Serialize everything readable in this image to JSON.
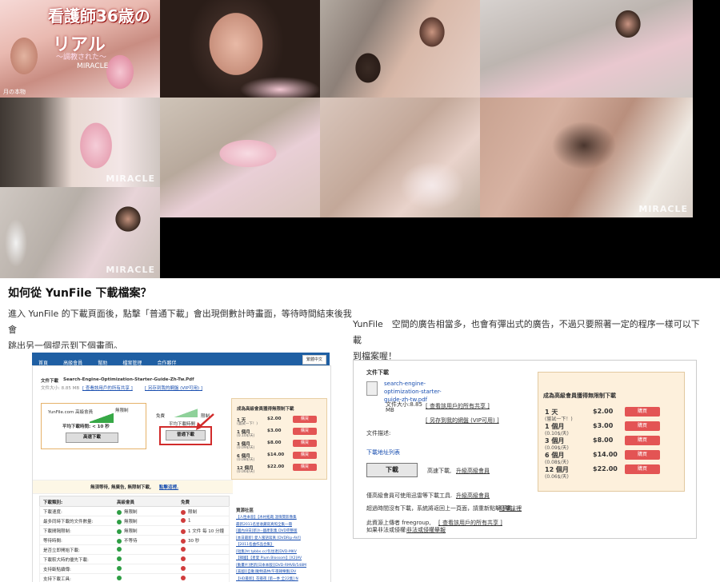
{
  "cover": {
    "title": "看護師36歳の",
    "subtitle": "リアル",
    "tagline": "～調教された～",
    "brand": "MIRACLE",
    "side_text": "月の本物"
  },
  "watermark": "MIRACLE",
  "section": {
    "heading": "如何從 YunFile 下載檔案？",
    "left_paragraph_line1": "進入 YunFile 的下載頁面後，點擊「普通下載」會出現倒數計時畫面，等待時間結束後我會",
    "left_paragraph_line2": "跳出另一個提示到下個畫面。",
    "right_paragraph_line1": "YunFile　空間的廣告相當多，也會有彈出式的廣告，不過只要照著一定的程序一樣可以下載",
    "right_paragraph_line2": "到檔案喔！"
  },
  "shot1": {
    "nav": [
      "首頁",
      "高級會員",
      "幫助",
      "檔案管理",
      "合作夥伴"
    ],
    "lang": "繁體中文",
    "file_heading": "文件下載",
    "file_name": "Search-Engine-Optimization-Starter-Guide-Zh-Tw.Pdf",
    "file_size": "文件大小: 8.85 MB",
    "link1": "[ 查看該用戶的所有共享 ]",
    "link2": "[ 另存到我的網盤 (VIP可用) ]",
    "site_box": "YunFile.com 高級會員",
    "no_limit": "無限制",
    "avg_time": "平均下載時間: < 10 秒",
    "fast_btn": "高速下載",
    "free_label": "免費",
    "limit_label": "限制",
    "avg_short": "平均下載時間",
    "normal_btn": "普通下載",
    "price_heading": "成為高級會員獲得無限制下載",
    "plans": [
      {
        "name": "1 天",
        "note": "(嘗試一下！)",
        "price": "$2.00",
        "btn": "購買"
      },
      {
        "name": "1 個月",
        "note": "(0.10$/天)",
        "price": "$3.00",
        "btn": "購買"
      },
      {
        "name": "3 個月",
        "note": "(0.09$/天)",
        "price": "$8.00",
        "btn": "購買"
      },
      {
        "name": "6 個月",
        "note": "(0.08$/天)",
        "price": "$14.00",
        "btn": "購買"
      },
      {
        "name": "12 個月",
        "note": "(0.06$/天)",
        "price": "$22.00",
        "btn": "購買"
      }
    ],
    "banner": "無須等待, 無廣告, 無限制下載,",
    "banner_link": "點擊這裡.",
    "table_headers": [
      "下載類別:",
      "高級會員",
      "免費"
    ],
    "table_rows": [
      {
        "label": "下載速度:",
        "vip": "無限制",
        "free": "限制"
      },
      {
        "label": "最多同時下載的文件數量:",
        "vip": "無限制",
        "free": "1"
      },
      {
        "label": "下載間隔限制:",
        "vip": "無限制",
        "free": "1 文件 每 10 分鐘"
      },
      {
        "label": "等待時間:",
        "vip": "不等待",
        "free": "30 秒"
      },
      {
        "label": "是否立即開始下載:",
        "vip": "",
        "free": ""
      },
      {
        "label": "下載較大時的優先下載:",
        "vip": "",
        "free": ""
      },
      {
        "label": "支持斷點續傳:",
        "vip": "",
        "free": ""
      },
      {
        "label": "支持下載工具:",
        "vip": "",
        "free": ""
      }
    ],
    "hot_heading": "資源社區",
    "hot_items": [
      "【人性本惡】【木村拓哉 溫情獎影像集",
      "最新2011名星收藏寫真照全集一冊",
      "[國內/8日]新沙--國產影集 DVD完整版",
      "[本日最新] 愛人蜜語寫真 [DVDRip-AVI]",
      "【2011名曲作品合集】",
      "[短集]ht tpbbs.cc/包住達[DVD-MKV",
      "【韓國】【星愛 Plum Blossom】[X2]AV",
      "[動畫片]更新[日本本版][DVD-RMVB/548M",
      "[美國][自動]動物森林/午夜韓樂集[DV",
      "【HD最新】花瓣夜 [第一季 全22集] N"
    ]
  },
  "shot2": {
    "file_heading": "文件下載",
    "file_name": "search-engine-optimization-starter-guide-zh-tw.pdf",
    "size_label": "文件大小:8.85",
    "size_unit": "MB",
    "link1": "[ 查看該用戶的所有共享 ]",
    "link2": "[ 另存到我的網盤 (VIP可用) ]",
    "desc_label": "文件描述:",
    "list_link": "下載地址列表",
    "download_btn": "下載",
    "fast_text": "高速下載,",
    "upgrade_link": "升級高級會員",
    "price_heading": "成為高級會員獲得無限制下載",
    "plans": [
      {
        "name": "1 天",
        "note": "(嘗試一下！)",
        "price": "$2.00",
        "btn": "購買"
      },
      {
        "name": "1 個月",
        "note": "(0.10$/天)",
        "price": "$3.00",
        "btn": "購買"
      },
      {
        "name": "3 個月",
        "note": "(0.09$/天)",
        "price": "$8.00",
        "btn": "購買"
      },
      {
        "name": "6 個月",
        "note": "(0.08$/天)",
        "price": "$14.00",
        "btn": "購買"
      },
      {
        "name": "12 個月",
        "note": "(0.06$/天)",
        "price": "$22.00",
        "btn": "購買"
      }
    ],
    "tip1": "僅高級會員可使用迅雷等下載工具.",
    "tip1_link": "升級高級會員",
    "tip2": "超過時間沒有下載，系統將返回上一頁面，請重新點擊下載，",
    "tip2_link": "點擊這裡",
    "tip3": "此資源上傳者 freegroup,",
    "tip3_link": "[ 查看該用戶的所有共享 ]",
    "tip4": "如果非法或侵權:",
    "tip4_link": "非法或侵權舉報"
  }
}
